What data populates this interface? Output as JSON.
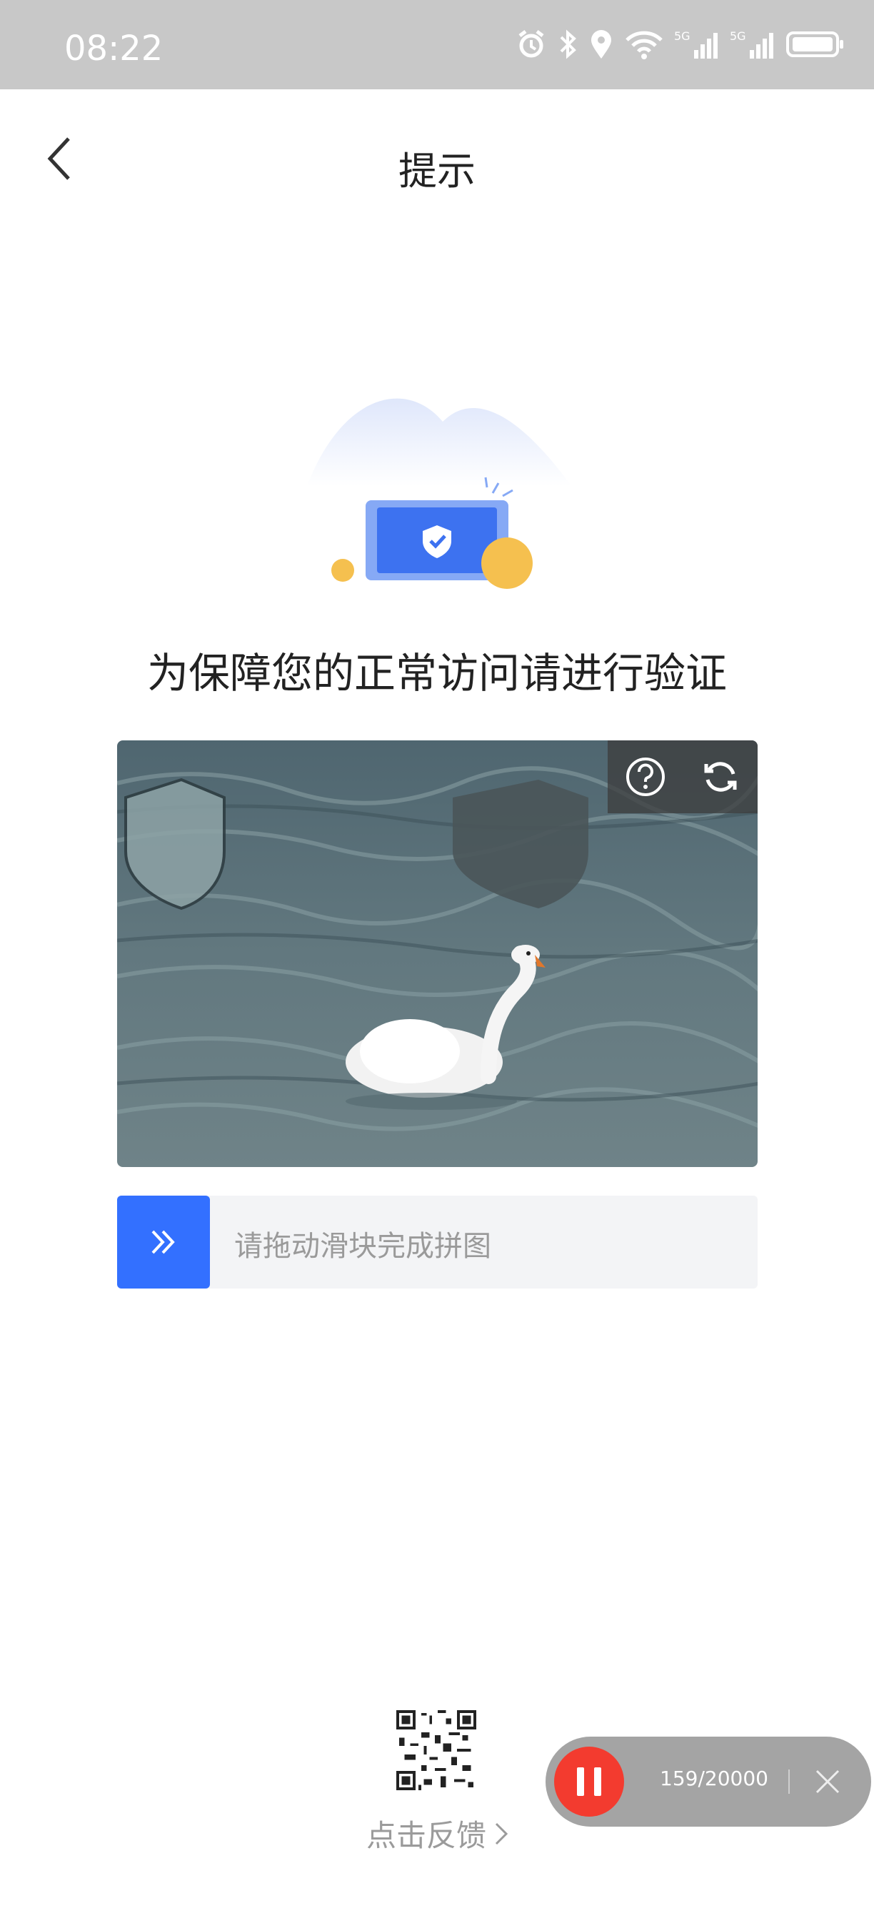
{
  "status_bar": {
    "time": "08:22"
  },
  "nav": {
    "title": "提示"
  },
  "headline": "为保障您的正常访问请进行验证",
  "slider": {
    "hint": "请拖动滑块完成拼图"
  },
  "feedback": {
    "label": "点击反馈"
  },
  "recorder": {
    "count": "159/20000"
  },
  "colors": {
    "accent": "#3370ff",
    "record": "#f33b2f",
    "status_bar": "#c8c8c8"
  }
}
